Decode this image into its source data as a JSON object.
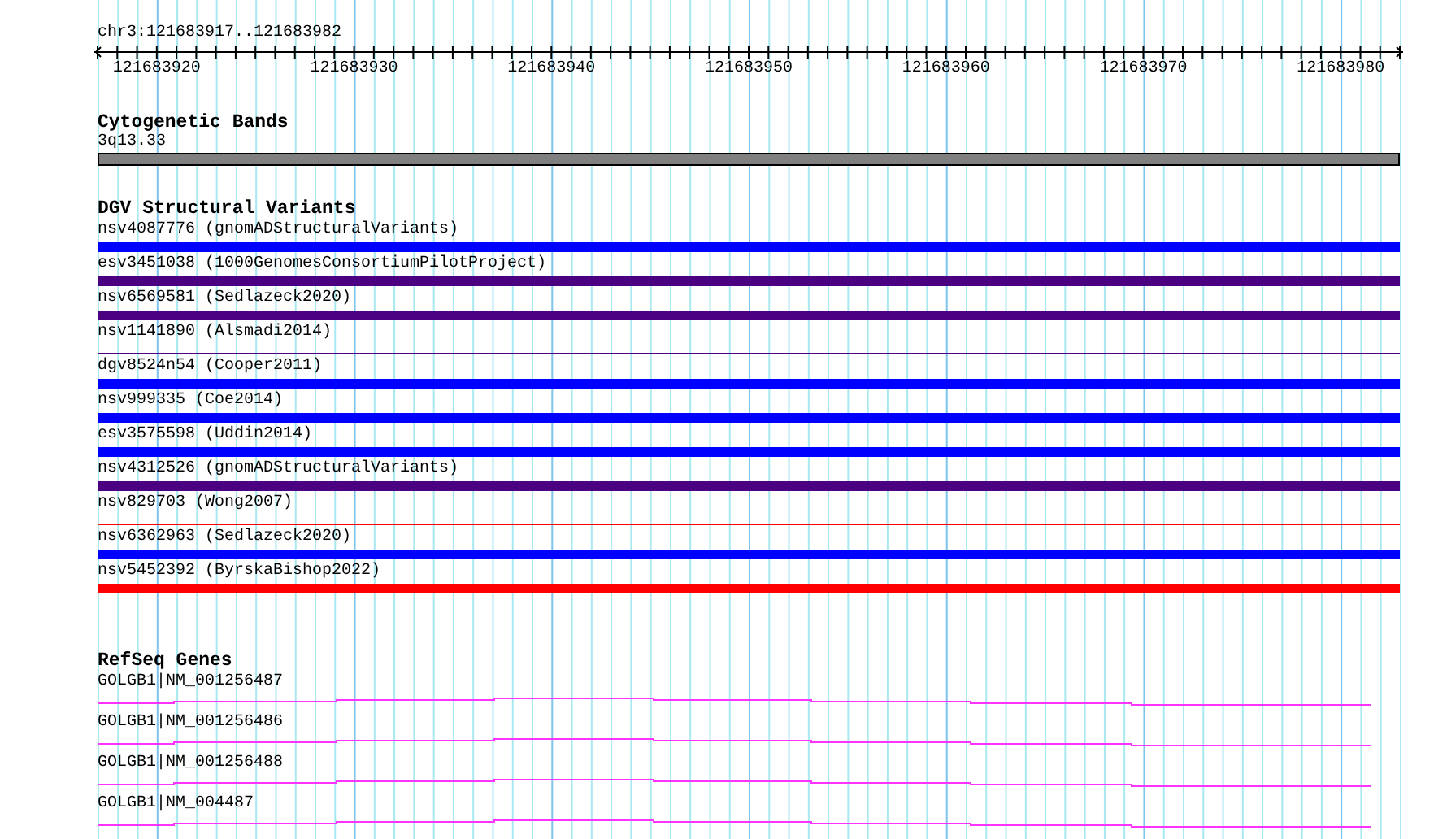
{
  "location": "chr3:121683917..121683982",
  "ruler": {
    "labels": [
      "121683920",
      "121683930",
      "121683940",
      "121683950",
      "121683960",
      "121683970",
      "121683980"
    ]
  },
  "cytogenetic_bands": {
    "title": "Cytogenetic Bands",
    "bands": [
      {
        "name": "3q13.33"
      }
    ]
  },
  "dgv": {
    "title": "DGV Structural Variants",
    "variants": [
      {
        "label": "nsv4087776 (gnomADStructuralVariants)",
        "color": "#0000ff",
        "kind": "thick"
      },
      {
        "label": "esv3451038 (1000GenomesConsortiumPilotProject)",
        "color": "#4b0082",
        "kind": "thick"
      },
      {
        "label": "nsv6569581 (Sedlazeck2020)",
        "color": "#4b0082",
        "kind": "thick"
      },
      {
        "label": "nsv1141890 (Alsmadi2014)",
        "color": "#4b0082",
        "kind": "thin"
      },
      {
        "label": "dgv8524n54 (Cooper2011)",
        "color": "#0000ff",
        "kind": "thick"
      },
      {
        "label": "nsv999335 (Coe2014)",
        "color": "#0000ff",
        "kind": "thick"
      },
      {
        "label": "esv3575598 (Uddin2014)",
        "color": "#0000ff",
        "kind": "thick"
      },
      {
        "label": "nsv4312526 (gnomADStructuralVariants)",
        "color": "#4b0082",
        "kind": "thick"
      },
      {
        "label": "nsv829703 (Wong2007)",
        "color": "#ff0000",
        "kind": "thin"
      },
      {
        "label": "nsv6362963 (Sedlazeck2020)",
        "color": "#0000ff",
        "kind": "thick"
      },
      {
        "label": "nsv5452392 (ByrskaBishop2022)",
        "color": "#ff0000",
        "kind": "thick"
      }
    ]
  },
  "refseq": {
    "title": "RefSeq Genes",
    "genes": [
      {
        "label": "GOLGB1|NM_001256487"
      },
      {
        "label": "GOLGB1|NM_001256486"
      },
      {
        "label": "GOLGB1|NM_001256488"
      },
      {
        "label": "GOLGB1|NM_004487"
      }
    ]
  }
}
